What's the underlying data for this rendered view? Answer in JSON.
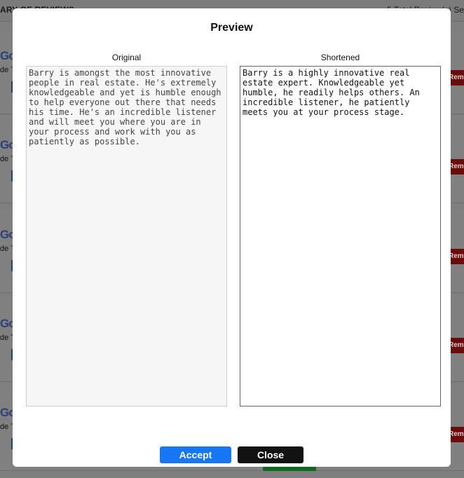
{
  "background": {
    "header_left": "ARY OF REVIEWS",
    "header_right": "5 Total Review(s) Se",
    "rows": [
      {
        "logo": "Go",
        "name": "de T",
        "remove_label": "Remo"
      },
      {
        "logo": "Go",
        "name": "de T",
        "remove_label": "Remo"
      },
      {
        "logo": "Go",
        "name": "de T",
        "remove_label": "Remo"
      },
      {
        "logo": "Go",
        "name": "de T",
        "remove_label": "Remo"
      },
      {
        "logo": "Go",
        "name": "de T",
        "remove_label": "Remo"
      }
    ]
  },
  "modal": {
    "title": "Preview",
    "original_label": "Original",
    "shortened_label": "Shortened",
    "original_text": "Barry is amongst the most innovative people in real estate. He's extremely knowledgeable and yet is humble enough to help everyone out there that needs his time. He's an incredible listener and will meet you where you are in your process and work with you as patiently as possible.",
    "shortened_text": "Barry is a highly innovative real estate expert. Knowledgeable yet humble, he readily helps others. An incredible listener, he patiently meets you at your process stage.",
    "accept_label": "Accept",
    "close_label": "Close"
  },
  "colors": {
    "accept": "#1676f3",
    "close": "#121212",
    "remove": "#d61c1c"
  }
}
